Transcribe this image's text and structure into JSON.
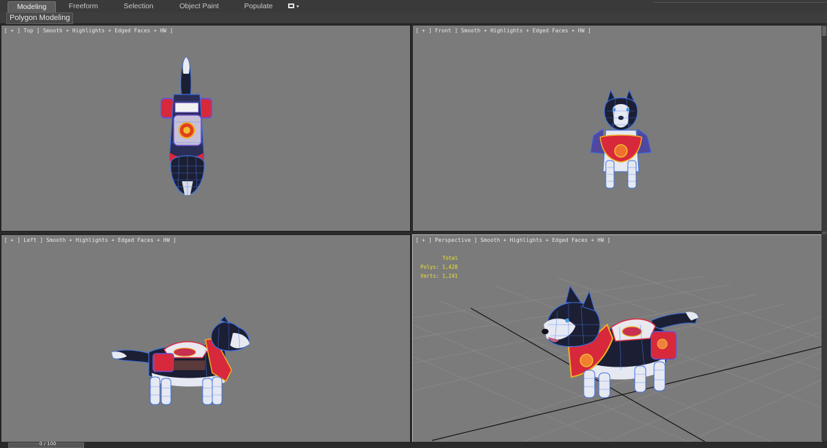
{
  "ribbon": {
    "tabs": [
      {
        "label": "Modeling",
        "active": true
      },
      {
        "label": "Freeform",
        "active": false
      },
      {
        "label": "Selection",
        "active": false
      },
      {
        "label": "Object Paint",
        "active": false
      },
      {
        "label": "Populate",
        "active": false
      }
    ],
    "panel_label": "Polygon Modeling"
  },
  "viewports": {
    "top": {
      "label": "[ + ] Top ] Smooth + Highlights + Edged Faces + HW ]"
    },
    "front": {
      "label": "[ + ] Front ] Smooth + Highlights + Edged Faces + HW ]"
    },
    "left": {
      "label": "[ + ] Left ] Smooth + Highlights + Edged Faces + HW ]"
    },
    "perspective": {
      "label": "[ + ] Perspective ] Smooth + Highlights + Edged Faces + HW ]",
      "active": true,
      "stats": {
        "header": "Total",
        "polys": "Polys: 1,428",
        "verts": "Verts: 1,241"
      }
    }
  },
  "timeline": {
    "frame_text": "0 / 100"
  },
  "colors": {
    "viewport_bg": "#7b7b7b",
    "wire": "#3a6fe0",
    "armor_red": "#d8283c",
    "fur_dark": "#1c1f33",
    "fur_light": "#e6e9f2",
    "stats_yellow": "#e8e233"
  }
}
